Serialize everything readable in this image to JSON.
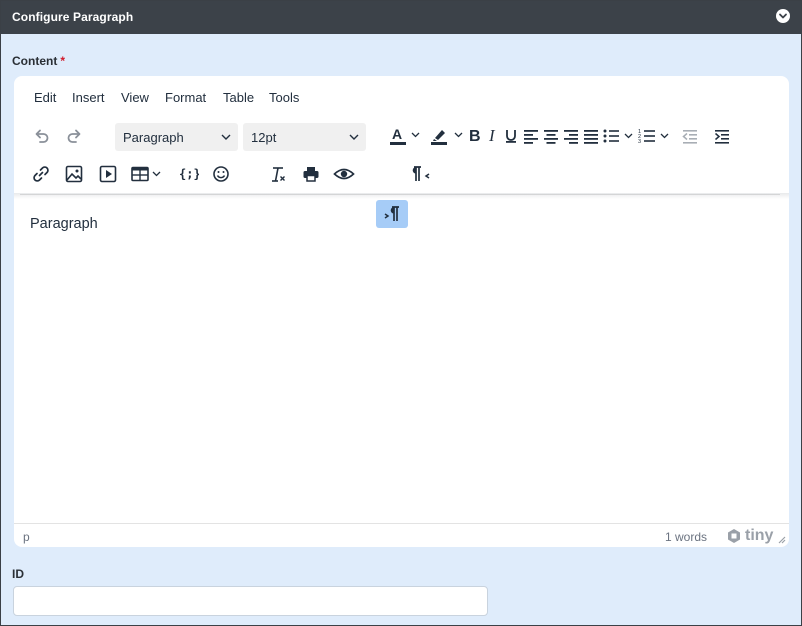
{
  "panel": {
    "title": "Configure Paragraph"
  },
  "content_field": {
    "label": "Content",
    "required_mark": "*"
  },
  "editor": {
    "menu": [
      "Edit",
      "Insert",
      "View",
      "Format",
      "Table",
      "Tools"
    ],
    "block_format": "Paragraph",
    "font_size": "12pt",
    "body_text": "Paragraph",
    "status_path": "p",
    "word_count": "1 words",
    "brand": "tiny"
  },
  "id_field": {
    "label": "ID",
    "value": "",
    "placeholder": ""
  },
  "colors": {
    "header": "#3c4249",
    "panel_bg": "#dfecfb",
    "active_button": "#a6ccf7",
    "required": "#d11a2a"
  }
}
